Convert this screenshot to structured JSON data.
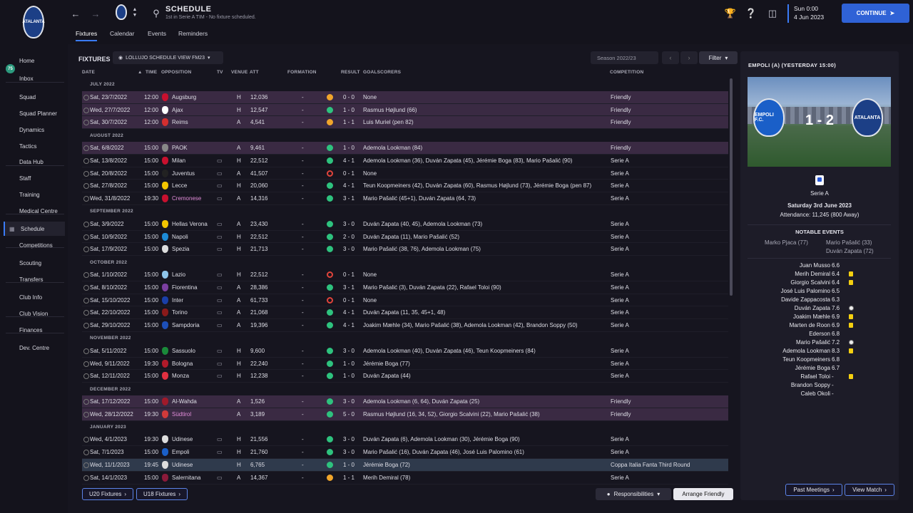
{
  "header": {
    "title": "SCHEDULE",
    "subtitle": "1st in Serie A TIM - No fixture scheduled.",
    "tabs": [
      "Fixtures",
      "Calendar",
      "Events",
      "Reminders"
    ],
    "clock_day": "Sun 0:00",
    "clock_date": "4 Jun 2023",
    "continue_label": "CONTINUE",
    "crest_text": "ATALANTA"
  },
  "sidebar": {
    "inbox_count": "75",
    "items": [
      "Home",
      "Inbox",
      "Squad",
      "Squad Planner",
      "Dynamics",
      "Tactics",
      "Data Hub",
      "Staff",
      "Training",
      "Medical Centre",
      "Schedule",
      "Competitions",
      "Scouting",
      "Transfers",
      "Club Info",
      "Club Vision",
      "Finances",
      "Dev. Centre"
    ]
  },
  "toolbar": {
    "section_label": "FIXTURES",
    "view_label": "LOLLUJO SCHEDULE VIEW FM23",
    "season_label": "Season 2022/23",
    "filter_label": "Filter"
  },
  "columns": {
    "date": "DATE",
    "time": "TIME",
    "opposition": "OPPOSITION",
    "tv": "TV",
    "venue": "VENUE",
    "att": "ATT",
    "formation": "FORMATION",
    "result": "RESULT",
    "goalscorers": "GOALSCORERS",
    "competition": "COMPETITION"
  },
  "fixtures": [
    {
      "month": "JULY 2022",
      "rows": [
        {
          "date": "Sat, 23/7/2022",
          "time": "12:00",
          "opp": "Augsburg",
          "tv": false,
          "venue": "H",
          "att": "12,036",
          "formation": "-",
          "res": "d",
          "score": "0 - 0",
          "scorers": "None",
          "comp": "Friendly",
          "friendly": true,
          "crest": "#c8102e"
        },
        {
          "date": "Wed, 27/7/2022",
          "time": "12:00",
          "opp": "Ajax",
          "tv": false,
          "venue": "H",
          "att": "12,547",
          "formation": "-",
          "res": "w",
          "score": "1 - 0",
          "scorers": "Rasmus Højlund (66)",
          "comp": "Friendly",
          "friendly": true,
          "crest": "#ffffff"
        },
        {
          "date": "Sat, 30/7/2022",
          "time": "12:00",
          "opp": "Reims",
          "tv": false,
          "venue": "A",
          "att": "4,541",
          "formation": "-",
          "res": "d",
          "score": "1 - 1",
          "scorers": "Luis Muriel (pen 82)",
          "comp": "Friendly",
          "friendly": true,
          "crest": "#d32f2f"
        }
      ]
    },
    {
      "month": "AUGUST 2022",
      "rows": [
        {
          "date": "Sat, 6/8/2022",
          "time": "15:00",
          "opp": "PAOK",
          "tv": false,
          "venue": "A",
          "att": "9,461",
          "formation": "-",
          "res": "w",
          "score": "1 - 0",
          "scorers": "Ademola Lookman (84)",
          "comp": "Friendly",
          "friendly": true,
          "crest": "#888888"
        },
        {
          "date": "Sat, 13/8/2022",
          "time": "15:00",
          "opp": "Milan",
          "tv": true,
          "venue": "H",
          "att": "22,512",
          "formation": "-",
          "res": "w",
          "score": "4 - 1",
          "scorers": "Ademola Lookman (36), Duván Zapata (45), Jérémie Boga (83), Mario Pašalić (90)",
          "comp": "Serie A",
          "crest": "#c8102e"
        },
        {
          "date": "Sat, 20/8/2022",
          "time": "15:00",
          "opp": "Juventus",
          "tv": true,
          "venue": "A",
          "att": "41,507",
          "formation": "-",
          "res": "l",
          "score": "0 - 1",
          "scorers": "None",
          "comp": "Serie A",
          "crest": "#222222"
        },
        {
          "date": "Sat, 27/8/2022",
          "time": "15:00",
          "opp": "Lecce",
          "tv": true,
          "venue": "H",
          "att": "20,060",
          "formation": "-",
          "res": "w",
          "score": "4 - 1",
          "scorers": "Teun Koopmeiners (42), Duván Zapata (60), Rasmus Højlund (73), Jérémie Boga (pen 87)",
          "comp": "Serie A",
          "crest": "#f2c500"
        },
        {
          "date": "Wed, 31/8/2022",
          "time": "19:30",
          "opp": "Cremonese",
          "oppPink": true,
          "tv": true,
          "venue": "A",
          "att": "14,316",
          "formation": "-",
          "res": "w",
          "score": "3 - 1",
          "scorers": "Mario Pašalić (45+1), Duván Zapata (64, 73)",
          "comp": "Serie A",
          "crest": "#c8102e"
        }
      ]
    },
    {
      "month": "SEPTEMBER 2022",
      "rows": [
        {
          "date": "Sat, 3/9/2022",
          "time": "15:00",
          "opp": "Hellas Verona",
          "tv": true,
          "venue": "A",
          "att": "23,430",
          "formation": "-",
          "res": "w",
          "score": "3 - 0",
          "scorers": "Duván Zapata (40, 45), Ademola Lookman (73)",
          "comp": "Serie A",
          "crest": "#f2c500"
        },
        {
          "date": "Sat, 10/9/2022",
          "time": "15:00",
          "opp": "Napoli",
          "tv": true,
          "venue": "H",
          "att": "22,512",
          "formation": "-",
          "res": "w",
          "score": "2 - 0",
          "scorers": "Duván Zapata (11), Mario Pašalić (52)",
          "comp": "Serie A",
          "crest": "#1d8bd6"
        },
        {
          "date": "Sat, 17/9/2022",
          "time": "15:00",
          "opp": "Spezia",
          "tv": true,
          "venue": "H",
          "att": "21,713",
          "formation": "-",
          "res": "w",
          "score": "3 - 0",
          "scorers": "Mario Pašalić (38, 76), Ademola Lookman (75)",
          "comp": "Serie A",
          "crest": "#dddddd"
        }
      ]
    },
    {
      "month": "OCTOBER 2022",
      "rows": [
        {
          "date": "Sat, 1/10/2022",
          "time": "15:00",
          "opp": "Lazio",
          "tv": true,
          "venue": "H",
          "att": "22,512",
          "formation": "-",
          "res": "l",
          "score": "0 - 1",
          "scorers": "None",
          "comp": "Serie A",
          "crest": "#8ec5ea"
        },
        {
          "date": "Sat, 8/10/2022",
          "time": "15:00",
          "opp": "Fiorentina",
          "tv": true,
          "venue": "A",
          "att": "28,386",
          "formation": "-",
          "res": "w",
          "score": "3 - 1",
          "scorers": "Mario Pašalić (3), Duván Zapata (22), Rafael Toloi (90)",
          "comp": "Serie A",
          "crest": "#7b3fa0"
        },
        {
          "date": "Sat, 15/10/2022",
          "time": "15:00",
          "opp": "Inter",
          "tv": true,
          "venue": "A",
          "att": "61,733",
          "formation": "-",
          "res": "l",
          "score": "0 - 1",
          "scorers": "None",
          "comp": "Serie A",
          "crest": "#1a3fa8"
        },
        {
          "date": "Sat, 22/10/2022",
          "time": "15:00",
          "opp": "Torino",
          "tv": true,
          "venue": "A",
          "att": "21,068",
          "formation": "-",
          "res": "w",
          "score": "4 - 1",
          "scorers": "Duván Zapata (11, 35, 45+1, 48)",
          "comp": "Serie A",
          "crest": "#8b1a1a"
        },
        {
          "date": "Sat, 29/10/2022",
          "time": "15:00",
          "opp": "Sampdoria",
          "tv": true,
          "venue": "A",
          "att": "19,396",
          "formation": "-",
          "res": "w",
          "score": "4 - 1",
          "scorers": "Joakim Mæhle (34), Mario Pašalić (38), Ademola Lookman (42), Brandon Soppy (50)",
          "comp": "Serie A",
          "crest": "#1d4fb8"
        }
      ]
    },
    {
      "month": "NOVEMBER 2022",
      "rows": [
        {
          "date": "Sat, 5/11/2022",
          "time": "15:00",
          "opp": "Sassuolo",
          "tv": true,
          "venue": "H",
          "att": "9,600",
          "formation": "-",
          "res": "w",
          "score": "3 - 0",
          "scorers": "Ademola Lookman (40), Duván Zapata (46), Teun Koopmeiners (84)",
          "comp": "Serie A",
          "crest": "#1a8a3a"
        },
        {
          "date": "Wed, 9/11/2022",
          "time": "19:30",
          "opp": "Bologna",
          "tv": true,
          "venue": "H",
          "att": "22,240",
          "formation": "-",
          "res": "w",
          "score": "1 - 0",
          "scorers": "Jérémie Boga (77)",
          "comp": "Serie A",
          "crest": "#b01a2a"
        },
        {
          "date": "Sat, 12/11/2022",
          "time": "15:00",
          "opp": "Monza",
          "tv": true,
          "venue": "H",
          "att": "12,238",
          "formation": "-",
          "res": "w",
          "score": "1 - 0",
          "scorers": "Duván Zapata (44)",
          "comp": "Serie A",
          "crest": "#e03040"
        }
      ]
    },
    {
      "month": "DECEMBER 2022",
      "rows": [
        {
          "date": "Sat, 17/12/2022",
          "time": "15:00",
          "opp": "Al-Wahda",
          "tv": false,
          "venue": "A",
          "att": "1,526",
          "formation": "-",
          "res": "w",
          "score": "3 - 0",
          "scorers": "Ademola Lookman (6, 64), Duván Zapata (25)",
          "comp": "Friendly",
          "friendly": true,
          "crest": "#a01a2a"
        },
        {
          "date": "Wed, 28/12/2022",
          "time": "19:30",
          "opp": "Südtirol",
          "oppPink": true,
          "tv": false,
          "venue": "A",
          "att": "3,189",
          "formation": "-",
          "res": "w",
          "score": "5 - 0",
          "scorers": "Rasmus Højlund (16, 34, 52), Giorgio Scalvini (22), Mario Pašalić (38)",
          "comp": "Friendly",
          "friendly": true,
          "crest": "#d03a3a"
        }
      ]
    },
    {
      "month": "JANUARY 2023",
      "rows": [
        {
          "date": "Wed, 4/1/2023",
          "time": "19:30",
          "opp": "Udinese",
          "tv": true,
          "venue": "H",
          "att": "21,556",
          "formation": "-",
          "res": "w",
          "score": "3 - 0",
          "scorers": "Duván Zapata (6), Ademola Lookman (30), Jérémie Boga (90)",
          "comp": "Serie A",
          "crest": "#dddddd"
        },
        {
          "date": "Sat, 7/1/2023",
          "time": "15:00",
          "opp": "Empoli",
          "tv": true,
          "venue": "H",
          "att": "21,760",
          "formation": "-",
          "res": "w",
          "score": "3 - 0",
          "scorers": "Mario Pašalić (16), Duván Zapata (46), José Luis Palomino (61)",
          "comp": "Serie A",
          "crest": "#1a5fc8"
        },
        {
          "date": "Wed, 11/1/2023",
          "time": "19:45",
          "opp": "Udinese",
          "tv": false,
          "venue": "H",
          "att": "6,765",
          "formation": "-",
          "res": "w",
          "score": "1 - 0",
          "scorers": "Jérémie Boga (72)",
          "comp": "Coppa Italia Fanta Third Round",
          "sel": true,
          "crest": "#dddddd"
        },
        {
          "date": "Sat, 14/1/2023",
          "time": "15:00",
          "opp": "Salernitana",
          "tv": true,
          "venue": "A",
          "att": "14,367",
          "formation": "-",
          "res": "d",
          "score": "1 - 1",
          "scorers": "Merih Demiral (78)",
          "comp": "Serie A",
          "crest": "#8b1a3a"
        }
      ]
    }
  ],
  "bottom": {
    "u20": "U20 Fixtures",
    "u18": "U18 Fixtures",
    "responsibilities": "Responsibilities",
    "arrange": "Arrange Friendly"
  },
  "match": {
    "title": "EMPOLI (A) (YESTERDAY 15:00)",
    "score": "1 - 2",
    "home_crest": "EMPOLI F.C.",
    "away_crest": "ATALANTA",
    "competition": "Serie A",
    "date": "Saturday 3rd June 2023",
    "attendance": "Attendance: 11,245 (800 Away)",
    "events_title": "NOTABLE EVENTS",
    "home_events": [
      "Marko Pjaca (77)"
    ],
    "away_events": [
      "Mario Pašalić (33)",
      "Duván Zapata (72)"
    ],
    "players": [
      {
        "name": "Juan Musso",
        "rating": "6.6",
        "icon": ""
      },
      {
        "name": "Merih Demiral",
        "rating": "6.4",
        "icon": "yc"
      },
      {
        "name": "Giorgio Scalvini",
        "rating": "6.4",
        "icon": "yc"
      },
      {
        "name": "José Luis Palomino",
        "rating": "6.5",
        "icon": ""
      },
      {
        "name": "Davide Zappacosta",
        "rating": "6.3",
        "icon": ""
      },
      {
        "name": "Duván Zapata",
        "rating": "7.6",
        "icon": "ball"
      },
      {
        "name": "Joakim Mæhle",
        "rating": "6.9",
        "icon": "yc"
      },
      {
        "name": "Marten de Roon",
        "rating": "6.9",
        "icon": "yc"
      },
      {
        "name": "Ederson",
        "rating": "6.8",
        "icon": ""
      },
      {
        "name": "Mario Pašalić",
        "rating": "7.2",
        "icon": "ball"
      },
      {
        "name": "Ademola Lookman",
        "rating": "8.3",
        "icon": "yc"
      },
      {
        "name": "Teun Koopmeiners",
        "rating": "6.8",
        "icon": ""
      },
      {
        "name": "Jérémie Boga",
        "rating": "6.7",
        "icon": ""
      },
      {
        "name": "Rafael Toloi",
        "rating": "-",
        "icon": "yc"
      },
      {
        "name": "Brandon Soppy",
        "rating": "-",
        "icon": ""
      },
      {
        "name": "Caleb Okoli",
        "rating": "-",
        "icon": ""
      }
    ],
    "past_meetings": "Past Meetings",
    "view_match": "View Match"
  },
  "colors": {
    "accent": "#3a7bf6",
    "win": "#2ec27e",
    "draw": "#f0a52b",
    "loss": "#e0443b",
    "friendly_row": "#3a2a43"
  }
}
